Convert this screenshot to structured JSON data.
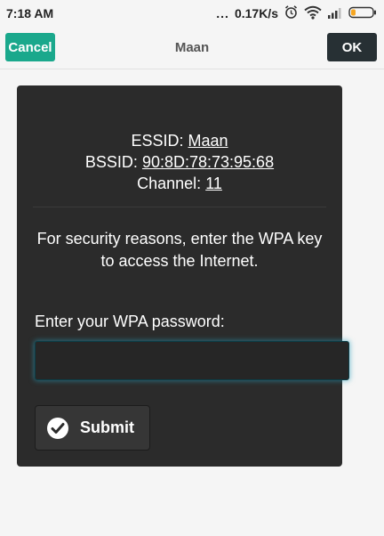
{
  "status_bar": {
    "time": "7:18 AM",
    "dots": "...",
    "net_speed": "0.17K/s",
    "icons": [
      "alarm-icon",
      "wifi-icon",
      "signal-icon",
      "battery-icon"
    ]
  },
  "title_bar": {
    "cancel_label": "Cancel",
    "title": "Maan",
    "ok_label": "OK"
  },
  "network": {
    "essid_label": "ESSID:",
    "essid": "Maan",
    "bssid_label": "BSSID:",
    "bssid": "90:8D:78:73:95:68",
    "channel_label": "Channel:",
    "channel": "11"
  },
  "message": {
    "line1": "For security reasons, enter the WPA key",
    "line2": "to access the Internet."
  },
  "form": {
    "password_label": "Enter your WPA password:",
    "password_value": "",
    "submit_label": "Submit",
    "submit_icon": "check-icon"
  },
  "colors": {
    "cancel_button": "#1aa88c",
    "ok_button": "#273034",
    "panel": "#2b2b2b",
    "input_glow": "#28a0be",
    "battery_accent": "#f5a623"
  }
}
